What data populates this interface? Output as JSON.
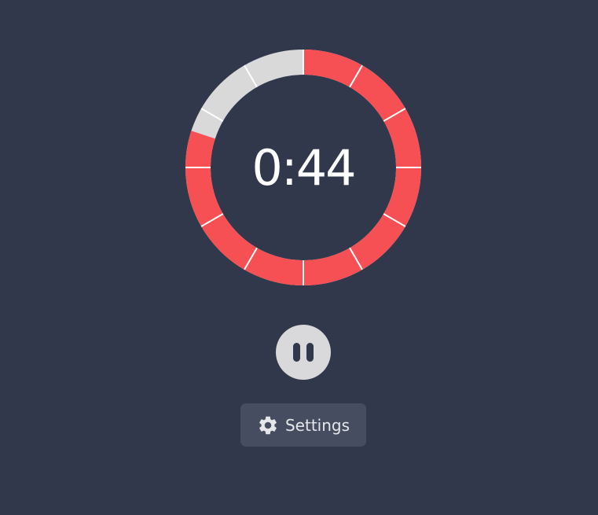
{
  "timer": {
    "time_text": "0:44",
    "remaining_fraction": 0.8,
    "segments": 12,
    "colors": {
      "remaining": "#f65054",
      "elapsed": "#d9d9d9",
      "divider": "#ffffff",
      "background": "#31384b"
    }
  },
  "controls": {
    "pause_icon": "pause-icon",
    "settings_icon": "gear-icon",
    "settings_label": "Settings"
  }
}
